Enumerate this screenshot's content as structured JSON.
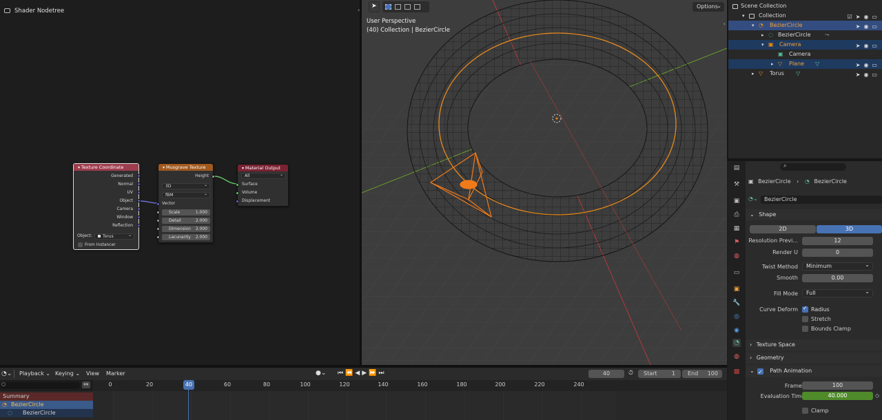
{
  "node_editor": {
    "title": "Shader Nodetree",
    "tex_coord": {
      "title": "Texture Coordinate",
      "outputs": [
        "Generated",
        "Normal",
        "UV",
        "Object",
        "Camera",
        "Window",
        "Reflection"
      ],
      "object_label": "Object:",
      "object_value": "Torus",
      "from_instancer": "From Instancer",
      "color": "#9e3d4d"
    },
    "musgrave": {
      "title": "Musgrave Texture",
      "output": "Height",
      "dim": "3D",
      "type": "fBM",
      "vector": "Vector",
      "fields": [
        {
          "label": "Scale",
          "value": "1.000"
        },
        {
          "label": "Detail",
          "value": "2.000"
        },
        {
          "label": "Dimension",
          "value": "2.000"
        },
        {
          "label": "Lacunarity",
          "value": "2.000"
        }
      ],
      "color": "#a0591f"
    },
    "material_output": {
      "title": "Material Output",
      "target": "All",
      "inputs": [
        "Surface",
        "Volume",
        "Displacement"
      ],
      "color": "#7a2232"
    }
  },
  "viewport": {
    "view_name": "User Perspective",
    "collection_info": "(40) Collection | BezierCircle",
    "options_label": "Options"
  },
  "outliner": {
    "rows": [
      {
        "label": "Scene Collection"
      },
      {
        "label": "Collection"
      },
      {
        "label": "BezierCircle"
      },
      {
        "label": "BezierCircle"
      },
      {
        "label": "Camera"
      },
      {
        "label": "Camera"
      },
      {
        "label": "Plane"
      },
      {
        "label": "Torus"
      }
    ]
  },
  "properties": {
    "breadcrumb_a": "BezierCircle",
    "breadcrumb_b": "BezierCircle",
    "datablock_name": "BezierCircle",
    "shape_section": "Shape",
    "dim_2d": "2D",
    "dim_3d": "3D",
    "resolution_label": "Resolution Previ...",
    "resolution_value": "12",
    "render_u_label": "Render U",
    "render_u_value": "0",
    "twist_label": "Twist Method",
    "twist_value": "Minimum",
    "smooth_label": "Smooth",
    "smooth_value": "0.00",
    "fill_label": "Fill Mode",
    "fill_value": "Full",
    "curve_deform_label": "Curve Deform",
    "radius_label": "Radius",
    "stretch_label": "Stretch",
    "bounds_clamp_label": "Bounds Clamp",
    "texture_space": "Texture Space",
    "geometry": "Geometry",
    "path_animation": "Path Animation",
    "frames_label": "Frames",
    "frames_value": "100",
    "eval_time_label": "Evaluation Time",
    "eval_time_value": "40.000",
    "clamp_label": "Clamp",
    "accent": "#4772b3",
    "anim_green": "#4f8a2b"
  },
  "timeline": {
    "menus": [
      "Playback",
      "Keying",
      "View",
      "Marker"
    ],
    "current_frame": "40",
    "start_label": "Start",
    "start_value": "1",
    "end_label": "End",
    "end_value": "100",
    "ruler": [
      "0",
      "20",
      "40",
      "60",
      "80",
      "100",
      "120",
      "140",
      "160",
      "180",
      "200",
      "220",
      "240"
    ],
    "summary": "Summary",
    "channel_1": "BezierCircle",
    "channel_2": "BezierCircle"
  }
}
